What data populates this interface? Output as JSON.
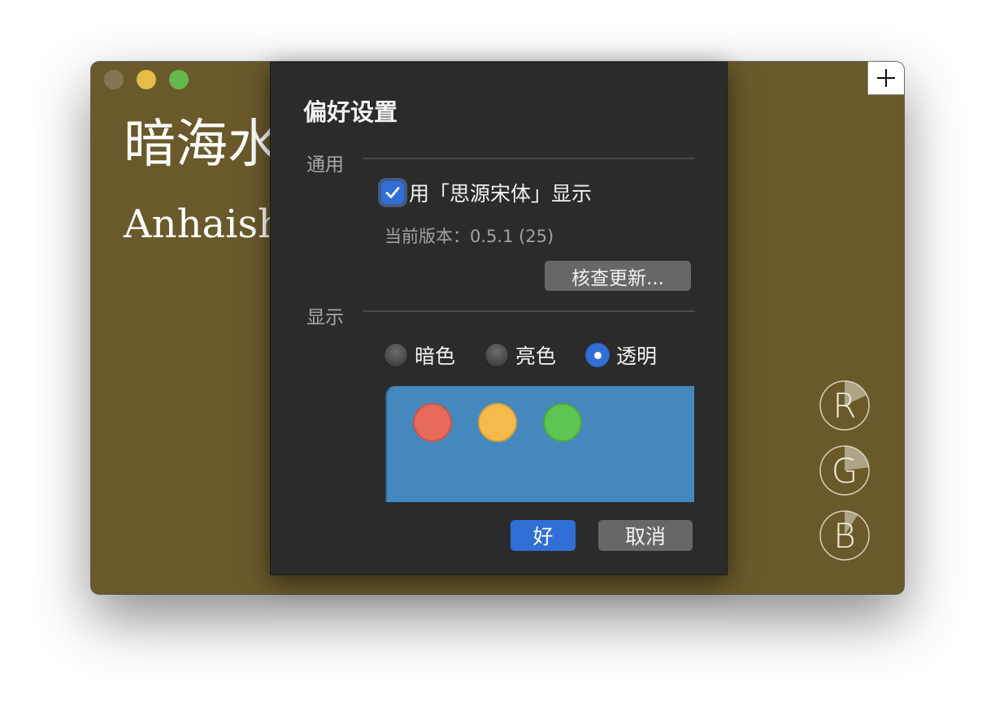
{
  "window": {
    "add_label": "+",
    "color_name_cn": "暗海水",
    "color_name_en": "Anhaishui",
    "background_color": "#6a5a2b",
    "channels": [
      {
        "name": "R",
        "level": 0.18
      },
      {
        "name": "G",
        "level": 0.23
      },
      {
        "name": "B",
        "level": 0.09
      }
    ]
  },
  "preferences": {
    "title": "偏好设置",
    "general_section": "通用",
    "use_font_label": "用「思源宋体」显示",
    "use_font_checked": true,
    "version_text": "当前版本：0.5.1 (25)",
    "check_update_label": "核查更新...",
    "display_section": "显示",
    "themes": [
      {
        "label": "暗色",
        "selected": false
      },
      {
        "label": "亮色",
        "selected": false
      },
      {
        "label": "透明",
        "selected": true
      }
    ],
    "preview_color": "#4488be",
    "ok_label": "好",
    "cancel_label": "取消"
  },
  "icons": {
    "checkbox": "checkmark-icon",
    "add": "plus-icon"
  },
  "colors": {
    "accent": "#2f6fd6",
    "sheet_background": "#2b2b2c"
  }
}
